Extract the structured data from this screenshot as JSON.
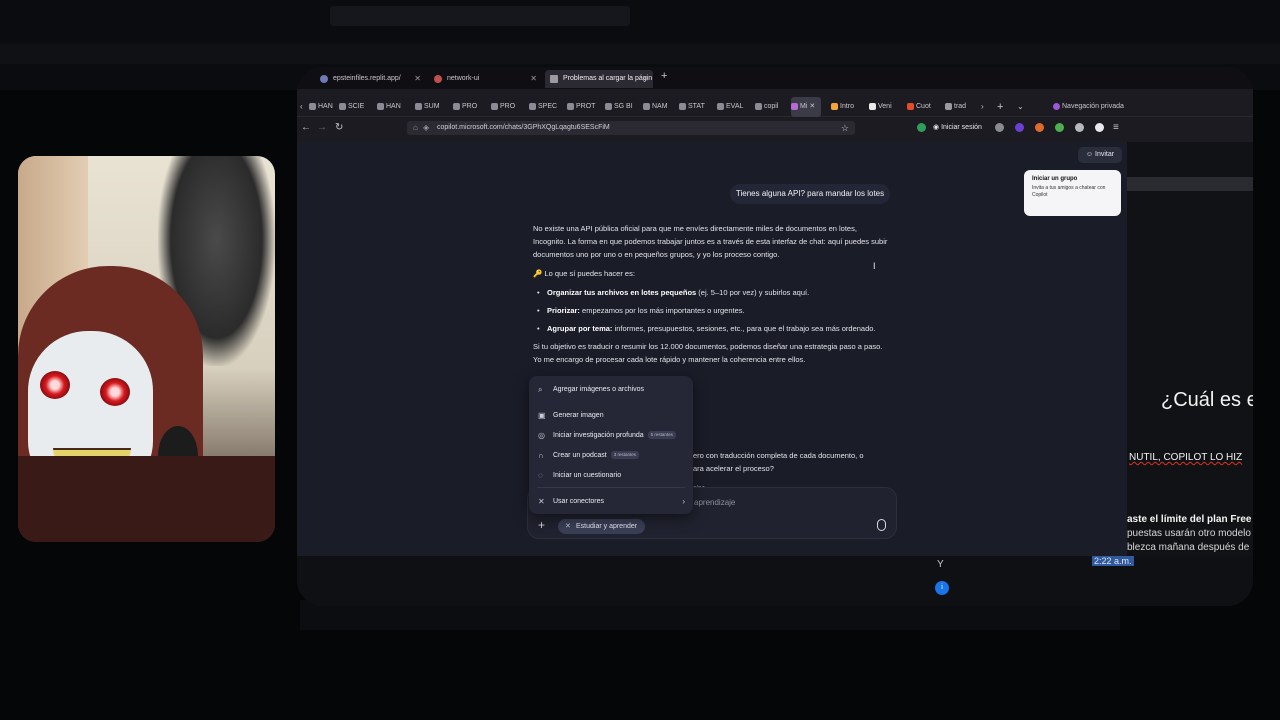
{
  "browser": {
    "tabs": [
      {
        "label": "epsteinfiles.replit.app/",
        "active": false
      },
      {
        "label": "network-ui",
        "active": false
      },
      {
        "label": "Problemas al cargar la págin",
        "active": true
      }
    ],
    "bookmarks": [
      "HAN",
      "SCIE",
      "HAN",
      "SUM",
      "PRO",
      "PRO",
      "SPEC",
      "PROT",
      "SG BI",
      "NAM",
      "STAT",
      "EVAL",
      "copil",
      "Mi",
      "Intro",
      "Veni",
      "Cuot",
      "trad"
    ],
    "private_label": "Navegación privada",
    "url": "copilot.microsoft.com/chats/3GPhXQgLqagtu6SEScFiM",
    "sign_in": "Iniciar sesión"
  },
  "copilot": {
    "invite_label": "Invitar",
    "group_card": {
      "title": "Iniciar un grupo",
      "description": "Invita a tus amigos a chatear con Copilot"
    },
    "user_message": "Tienes alguna API? para mandar los lotes",
    "answer": {
      "intro": "No existe una API pública oficial para que me envíes directamente miles de documentos en lotes, Incognito. La forma en que podemos trabajar juntos es a través de esta interfaz de chat: aquí puedes subir documentos uno por uno o en pequeños grupos, y yo los proceso contigo.",
      "can_do": "🔑 Lo que sí puedes hacer es:",
      "bullets": [
        {
          "bold": "Organizar tus archivos en lotes pequeños",
          "rest": " (ej. 5–10 por vez) y subirlos aquí."
        },
        {
          "bold": "Priorizar:",
          "rest": " empezamos por los más importantes o urgentes."
        },
        {
          "bold": "Agrupar por tema:",
          "rest": " informes, presupuestos, sesiones, etc., para que el trabajo sea más ordenado."
        }
      ],
      "strategy": "Si tu objetivo es traducir o resumir los 12.000 documentos, podemos diseñar una estrategia paso a paso. Yo me encargo de procesar cada lote rápido y mantener la coherencia entre ellos.",
      "partial_line_1": "ero con traducción completa de cada documento, o",
      "partial_line_2": "ara acelerar el proceso?",
      "partial_line_3": "gina"
    },
    "menu": [
      {
        "label": "Agregar imágenes o archivos",
        "icon": "paperclip-icon",
        "glyph": "⌕",
        "badge": ""
      },
      {
        "label": "Generar imagen",
        "icon": "image-icon",
        "glyph": "▣",
        "badge": ""
      },
      {
        "label": "Iniciar investigación profunda",
        "icon": "research-icon",
        "glyph": "◎",
        "badge": "5 restantes"
      },
      {
        "label": "Crear un podcast",
        "icon": "headphones-icon",
        "glyph": "∩",
        "badge": "3 restantes"
      },
      {
        "label": "Iniciar un cuestionario",
        "icon": "quiz-icon",
        "glyph": "◌",
        "badge": ""
      },
      {
        "label": "Usar conectores",
        "icon": "connectors-icon",
        "glyph": "✕",
        "badge": ""
      }
    ],
    "composer": {
      "placeholder": "aprendizaje",
      "mode_chip": "Estudiar y aprender"
    }
  },
  "background": {
    "heading": "¿Cuál es e",
    "caps_line": "NUTIL, COPILOT LO HIZ",
    "limit_title": "aste el límite del plan Free",
    "limit_line_1": "puestas usarán otro modelo",
    "limit_line_2": "blezca mañana después de",
    "timestamp": "2:22 a.m."
  }
}
